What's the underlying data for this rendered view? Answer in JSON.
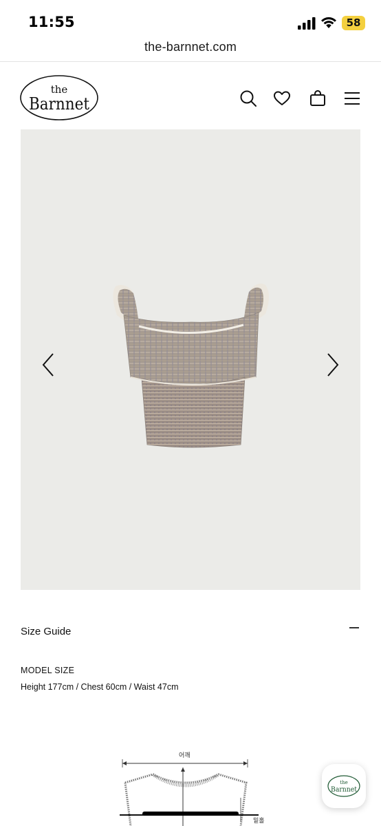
{
  "status_bar": {
    "time": "11:55",
    "battery": "58"
  },
  "browser": {
    "url": "the-barnnet.com"
  },
  "header": {
    "logo_text_top": "the",
    "logo_text_main": "Barnnet",
    "icons": [
      "search-icon",
      "heart-icon",
      "bag-icon",
      "menu-icon"
    ]
  },
  "gallery": {
    "background_color": "#ebebe8"
  },
  "size_guide": {
    "label": "Size Guide"
  },
  "model": {
    "title": "MODEL SIZE",
    "detail": "Height 177cm / Chest 60cm / Waist 47cm"
  },
  "diagram": {
    "shoulder_label": "어깨",
    "side_label": "밑홀"
  },
  "float_badge": {
    "text_top": "the",
    "text_main": "Barnnet",
    "color": "#1f5a34"
  }
}
